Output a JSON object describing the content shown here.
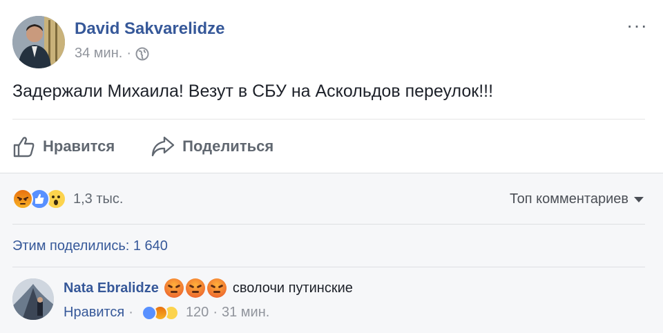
{
  "post": {
    "author": "David Sakvarelidze",
    "time": "34 мин.",
    "separator": "·",
    "more_label": "···",
    "text": "Задержали Михаила! Везут в СБУ на Аскольдов переулок!!!",
    "visibility_icon": "globe-icon"
  },
  "actions": {
    "like_label": "Нравится",
    "share_label": "Поделиться"
  },
  "feedback": {
    "reactions": [
      "angry",
      "like",
      "wow"
    ],
    "reaction_count": "1,3 тыс.",
    "sort_label": "Топ комментариев",
    "shares_label": "Этим поделились: 1 640"
  },
  "comment": {
    "author": "Nata Ebralidze",
    "emojis": [
      "angry",
      "angry",
      "angry"
    ],
    "text": "сволочи путинские",
    "like_label": "Нравится",
    "sep1": "·",
    "reactions": [
      "like",
      "angry",
      "haha"
    ],
    "reaction_count": "120",
    "sep2": "·",
    "time": "31 мин."
  },
  "colors": {
    "link": "#365899",
    "muted": "#90949c",
    "like_blue": "#5890ff",
    "feedback_bg": "#f6f7f9"
  }
}
